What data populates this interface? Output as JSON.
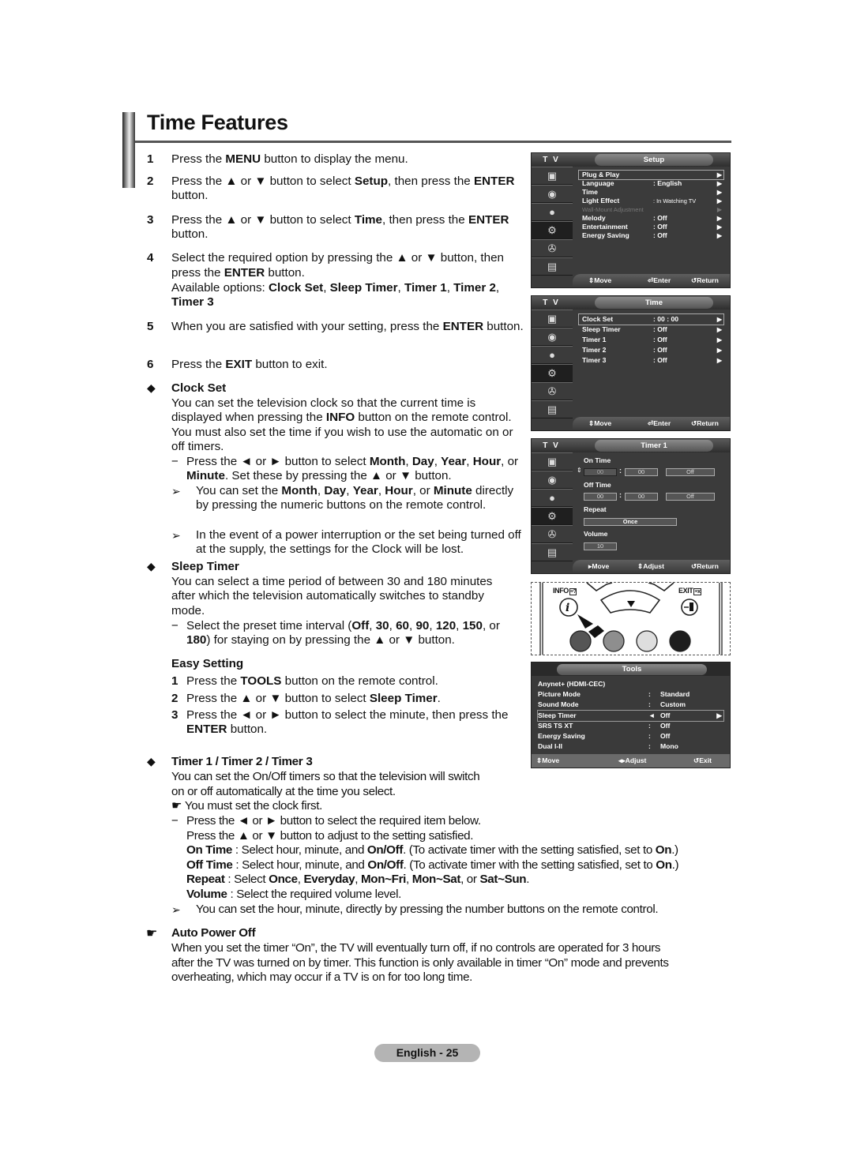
{
  "title": "Time Features",
  "steps": [
    {
      "num": "1",
      "html": "Press the <b>MENU</b> button to display the menu."
    },
    {
      "num": "2",
      "html": "Press the ▲ or ▼ button to select <b>Setup</b>, then press the <b>ENTER</b> button."
    },
    {
      "num": "3",
      "html": "Press the ▲ or ▼ button to select <b>Time</b>, then press the <b>ENTER</b> button."
    },
    {
      "num": "4",
      "html": "Select the required option by pressing the ▲ or ▼ button, then press the <b>ENTER</b> button.<br>Available options: <b>Clock Set</b>, <b>Sleep Timer</b>, <b>Timer 1</b>, <b>Timer 2</b>, <b>Timer 3</b>"
    },
    {
      "num": "5",
      "html": "When you are satisfied with your setting, press the <b>ENTER</b> button."
    },
    {
      "num": "6",
      "html": "Press the <b>EXIT</b> button to exit."
    }
  ],
  "clock_set": {
    "heading": "Clock Set",
    "body": "You can set the television clock so that the current time is displayed when pressing the <b>INFO</b> button on the remote control. You must also set the time if you wish to use the automatic on or off timers.",
    "dash": "Press the ◄ or ► button to select <b>Month</b>, <b>Day</b>, <b>Year</b>, <b>Hour</b>, or <b>Minute</b>. Set these by pressing the ▲ or ▼ button.",
    "notes": [
      "You can set the <b>Month</b>, <b>Day</b>, <b>Year</b>, <b>Hour</b>, or <b>Minute</b> directly by pressing the numeric buttons on the remote control.",
      "In the event of a power interruption or the set being turned off at the supply, the settings for the Clock will be lost."
    ]
  },
  "sleep_timer": {
    "heading": "Sleep Timer",
    "body": "You can select a time period of between 30 and 180 minutes after which the television automatically switches to standby mode.",
    "dash": "Select the preset time interval (<b>Off</b>, <b>30</b>, <b>60</b>, <b>90</b>, <b>120</b>, <b>150</b>, or <b>180</b>) for staying on by pressing the ▲ or ▼ button.",
    "easy_heading": "Easy Setting",
    "easy_steps": [
      {
        "num": "1",
        "html": "Press the <b>TOOLS</b> button on the remote control."
      },
      {
        "num": "2",
        "html": "Press the ▲ or ▼ button to select <b>Sleep Timer</b>."
      },
      {
        "num": "3",
        "html": "Press the ◄ or ► button to select the minute, then press the <b>ENTER</b> button."
      }
    ]
  },
  "timers": {
    "heading": "Timer 1 / Timer 2 / Timer 3",
    "body": "You can set the On/Off timers so that the television will switch<br>on or off automatically at the time you select.",
    "hand_note": "You must set the clock first.",
    "dash_lines": [
      "Press the ◄ or ► button to select the required item below.",
      "Press the ▲ or ▼ button to adjust to the setting satisfied.",
      "<b>On Time</b> : Select hour, minute, and <b>On/Off</b>. (To activate timer with the setting satisfied, set to <b>On</b>.)",
      "<b>Off Time</b> : Select hour, minute, and <b>On/Off</b>. (To activate timer with the setting satisfied, set to <b>On</b>.)",
      "<b>Repeat</b> : Select <b>Once</b>, <b>Everyday</b>, <b>Mon~Fri</b>, <b>Mon~Sat</b>, or <b>Sat~Sun</b>.",
      "<b>Volume</b> : Select the required volume level."
    ],
    "note": "You can set the hour, minute, directly by pressing the number buttons on the remote control."
  },
  "auto_power_off": {
    "heading": "Auto Power Off",
    "body": "When you set the timer “On”, the TV will eventually turn off, if no controls are operated for 3 hours<br>after the TV was turned on by timer. This function is only available in timer “On” mode and prevents<br>overheating, which may occur if a TV is on for too long time."
  },
  "osd_setup": {
    "tv_label": "T V",
    "title": "Setup",
    "rows": [
      {
        "label": "Plug & Play",
        "value": "",
        "selected": true
      },
      {
        "label": "Language",
        "value": ": English"
      },
      {
        "label": "Time",
        "value": ""
      },
      {
        "label": "Light Effect",
        "value": ": In Watching TV"
      },
      {
        "label": "Wall-Mount Adjustment",
        "value": "",
        "dim": true
      },
      {
        "label": "Melody",
        "value": ": Off"
      },
      {
        "label": "Entertainment",
        "value": ": Off"
      },
      {
        "label": "Energy Saving",
        "value": ": Off"
      }
    ],
    "footer": {
      "move": "Move",
      "enter": "Enter",
      "return": "Return"
    }
  },
  "osd_time": {
    "tv_label": "T V",
    "title": "Time",
    "rows": [
      {
        "label": "Clock Set",
        "value": ": 00 : 00",
        "selected": true
      },
      {
        "label": "Sleep Timer",
        "value": ": Off"
      },
      {
        "label": "Timer 1",
        "value": ": Off"
      },
      {
        "label": "Timer 2",
        "value": ": Off"
      },
      {
        "label": "Timer 3",
        "value": ": Off"
      }
    ],
    "footer": {
      "move": "Move",
      "enter": "Enter",
      "return": "Return"
    }
  },
  "osd_timer1": {
    "tv_label": "T V",
    "title": "Timer 1",
    "on_time_label": "On Time",
    "on_time": {
      "hour": "00",
      "minute": "00",
      "state": "Off"
    },
    "off_time_label": "Off Time",
    "off_time": {
      "hour": "00",
      "minute": "00",
      "state": "Off"
    },
    "repeat_label": "Repeat",
    "repeat": "Once",
    "volume_label": "Volume",
    "volume": "10",
    "footer": {
      "move": "Move",
      "adjust": "Adjust",
      "return": "Return"
    }
  },
  "remote": {
    "info_label": "INFO",
    "exit_label": "EXIT",
    "button_colors": [
      "#555555",
      "#8e8e8e",
      "#dedede",
      "#1e1e1e"
    ]
  },
  "osd_tools": {
    "title": "Tools",
    "rows": [
      {
        "label": "Anynet+ (HDMI-CEC)",
        "colon": "",
        "value": ""
      },
      {
        "label": "Picture Mode",
        "colon": ":",
        "value": "Standard"
      },
      {
        "label": "Sound Mode",
        "colon": ":",
        "value": "Custom"
      },
      {
        "label": "Sleep Timer",
        "colon": "◄",
        "value": "Off",
        "selected": true
      },
      {
        "label": "SRS TS XT",
        "colon": ":",
        "value": "Off"
      },
      {
        "label": "Energy Saving",
        "colon": ":",
        "value": "Off"
      },
      {
        "label": "Dual I-II",
        "colon": ":",
        "value": "Mono"
      }
    ],
    "footer": {
      "move": "Move",
      "adjust": "Adjust",
      "exit": "Exit"
    }
  },
  "page_label": "English - 25"
}
